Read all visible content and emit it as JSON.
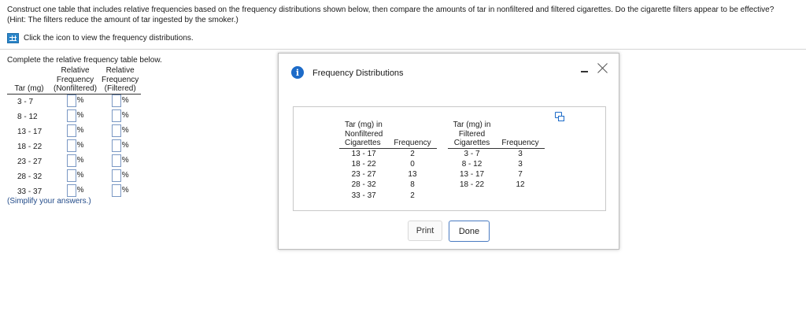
{
  "question": {
    "text": "Construct one table that includes relative frequencies based on the frequency distributions shown below, then compare the amounts of tar in nonfiltered and filtered cigarettes. Do the cigarette filters appear to be effective? (Hint: The filters reduce the amount of tar ingested by the smoker.)",
    "view_link": "Click the icon to view the frequency distributions."
  },
  "relative_table": {
    "instruction": "Complete the relative frequency table below.",
    "headers": {
      "tar": "Tar (mg)",
      "nonfiltered": [
        "Relative",
        "Frequency",
        "(Nonfiltered)"
      ],
      "filtered": [
        "Relative",
        "Frequency",
        "(Filtered)"
      ]
    },
    "percent_sign": "%",
    "rows": [
      "3 - 7",
      "8 - 12",
      "13 - 17",
      "18 - 22",
      "23 - 27",
      "28 - 32",
      "33 - 37"
    ],
    "note": "(Simplify your answers.)"
  },
  "dialog": {
    "title": "Frequency Distributions",
    "info_icon_glyph": "i",
    "nonfiltered_header": [
      "Tar (mg) in",
      "Nonfiltered",
      "Cigarettes"
    ],
    "filtered_header": [
      "Tar (mg) in",
      "Filtered",
      "Cigarettes"
    ],
    "frequency_header": "Frequency",
    "nonfiltered_rows": [
      {
        "tar": "13 - 17",
        "freq": "2"
      },
      {
        "tar": "18 - 22",
        "freq": "0"
      },
      {
        "tar": "23 - 27",
        "freq": "13"
      },
      {
        "tar": "28 - 32",
        "freq": "8"
      },
      {
        "tar": "33 - 37",
        "freq": "2"
      }
    ],
    "filtered_rows": [
      {
        "tar": "3 - 7",
        "freq": "3"
      },
      {
        "tar": "8 - 12",
        "freq": "3"
      },
      {
        "tar": "13 - 17",
        "freq": "7"
      },
      {
        "tar": "18 - 22",
        "freq": "12"
      },
      {
        "tar": "",
        "freq": ""
      }
    ],
    "print_label": "Print",
    "done_label": "Done"
  },
  "colors": {
    "accent": "#1d6bc8",
    "note_text": "#234c8a",
    "input_border": "#7a98c4"
  }
}
